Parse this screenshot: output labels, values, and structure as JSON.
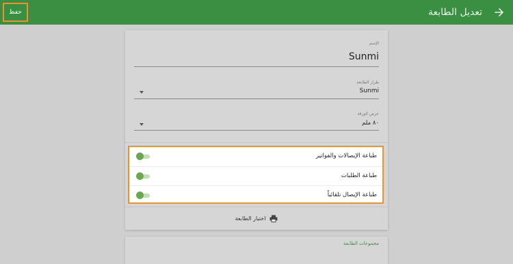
{
  "header": {
    "title": "تعديل الطابعة",
    "save_label": "حفظ",
    "back_icon": "arrow-right-icon"
  },
  "form": {
    "name": {
      "label": "الإسم",
      "value": "Sunmi"
    },
    "model": {
      "label": "طراز الطابعة",
      "value": "Sunmi"
    },
    "paper_width": {
      "label": "عرض الورقة",
      "value": "٨٠ ملم"
    }
  },
  "toggles": [
    {
      "label": "طباعة الإيصالات والفواتير",
      "on": false
    },
    {
      "label": "طباعة الطلبات",
      "on": false
    },
    {
      "label": "طباعة الإيصال تلقائياً",
      "on": false
    }
  ],
  "test_print": {
    "label": "اختبار الطابعة",
    "icon": "printer-icon"
  },
  "printer_groups": {
    "title": "مجموعات الطابعة"
  },
  "colors": {
    "primary": "#3a8f43",
    "highlight": "#f2902b",
    "toggle_knob": "#6aa84f"
  }
}
